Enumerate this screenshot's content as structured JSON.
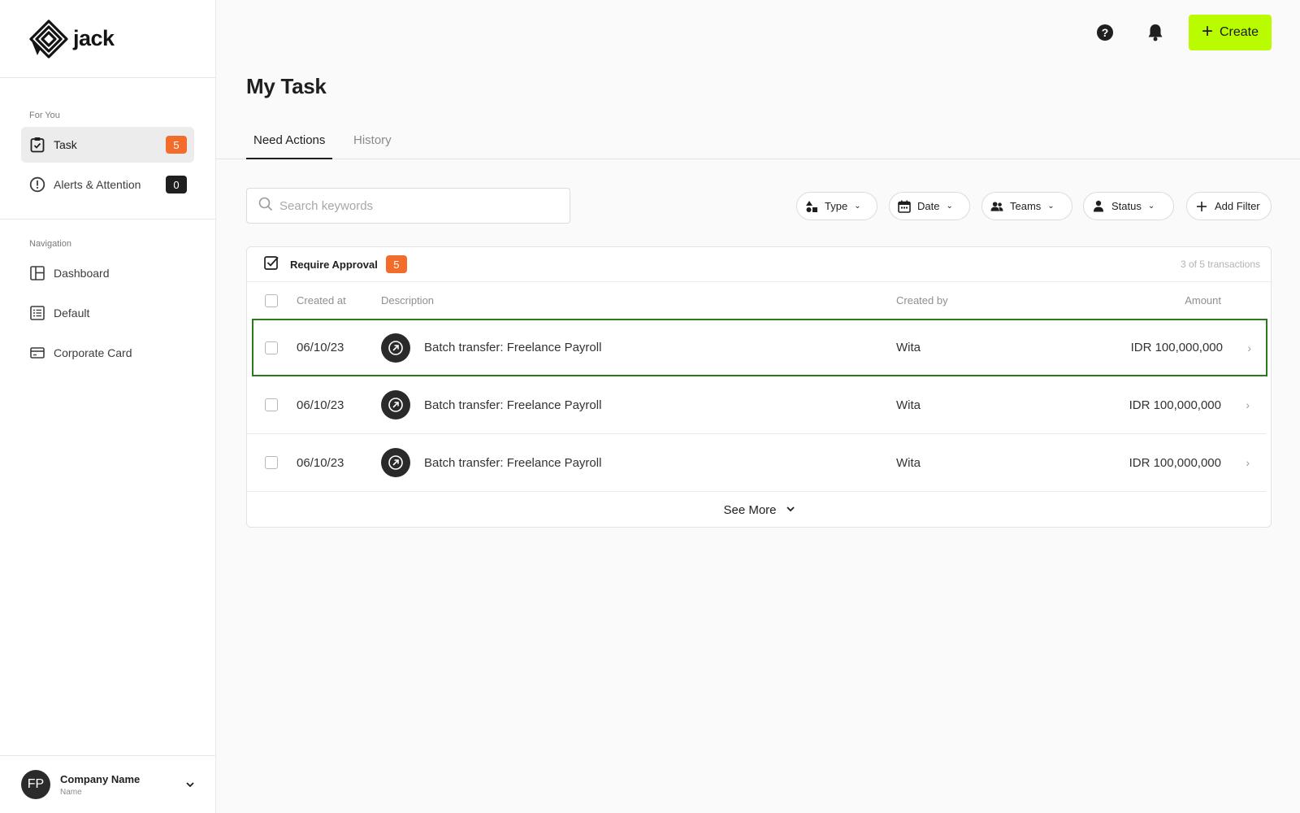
{
  "app": {
    "brand": "jack",
    "page_title": "My Task"
  },
  "colors": {
    "accent": "#b9fc00",
    "badge_orange": "#f26d2b",
    "badge_dark": "#1f1f1f",
    "selected_row_border": "#2b7a1d"
  },
  "header": {
    "help_icon": "help-circle-icon",
    "notifications_icon": "bell-icon",
    "create_label": "Create"
  },
  "sidebar": {
    "for_you_label": "For You",
    "for_you_items": [
      {
        "label": "Task",
        "count": "5",
        "icon": "task-check-icon",
        "active": true
      },
      {
        "label": "Alerts & Attention",
        "count": "0",
        "icon": "alert-circle-icon",
        "active": false
      }
    ],
    "navigation_label": "Navigation",
    "nav_items": [
      {
        "label": "Dashboard",
        "icon": "layout-icon"
      },
      {
        "label": "Default",
        "icon": "list-icon"
      },
      {
        "label": "Corporate Card",
        "icon": "card-icon"
      }
    ],
    "user": {
      "initials": "FP",
      "company": "Company Name",
      "sub": "Name"
    }
  },
  "tabs": [
    {
      "label": "Need Actions",
      "active": true
    },
    {
      "label": "History",
      "active": false
    }
  ],
  "search": {
    "placeholder": "Search keywords",
    "value": ""
  },
  "filters": [
    {
      "label": "Type",
      "icon": "shapes-icon"
    },
    {
      "label": "Date",
      "icon": "calendar-icon"
    },
    {
      "label": "Teams",
      "icon": "team-icon"
    },
    {
      "label": "Status",
      "icon": "person-icon"
    },
    {
      "label": "Add Filter",
      "icon": "plus-icon"
    }
  ],
  "approval_table": {
    "title": "Require Approval",
    "count": "5",
    "meta": "3 of 5 transactions",
    "columns": {
      "created_at": "Created at",
      "description": "Description",
      "created_by": "Created by",
      "amount": "Amount"
    },
    "rows": [
      {
        "date": "06/10/23",
        "description": "Batch transfer: Freelance Payroll",
        "created_by": "Wita",
        "amount": "IDR 100,000,000",
        "selected": true
      },
      {
        "date": "06/10/23",
        "description": "Batch transfer: Freelance Payroll",
        "created_by": "Wita",
        "amount": "IDR 100,000,000",
        "selected": false
      },
      {
        "date": "06/10/23",
        "description": "Batch transfer: Freelance Payroll",
        "created_by": "Wita",
        "amount": "IDR 100,000,000",
        "selected": false
      }
    ],
    "see_more_label": "See More"
  }
}
